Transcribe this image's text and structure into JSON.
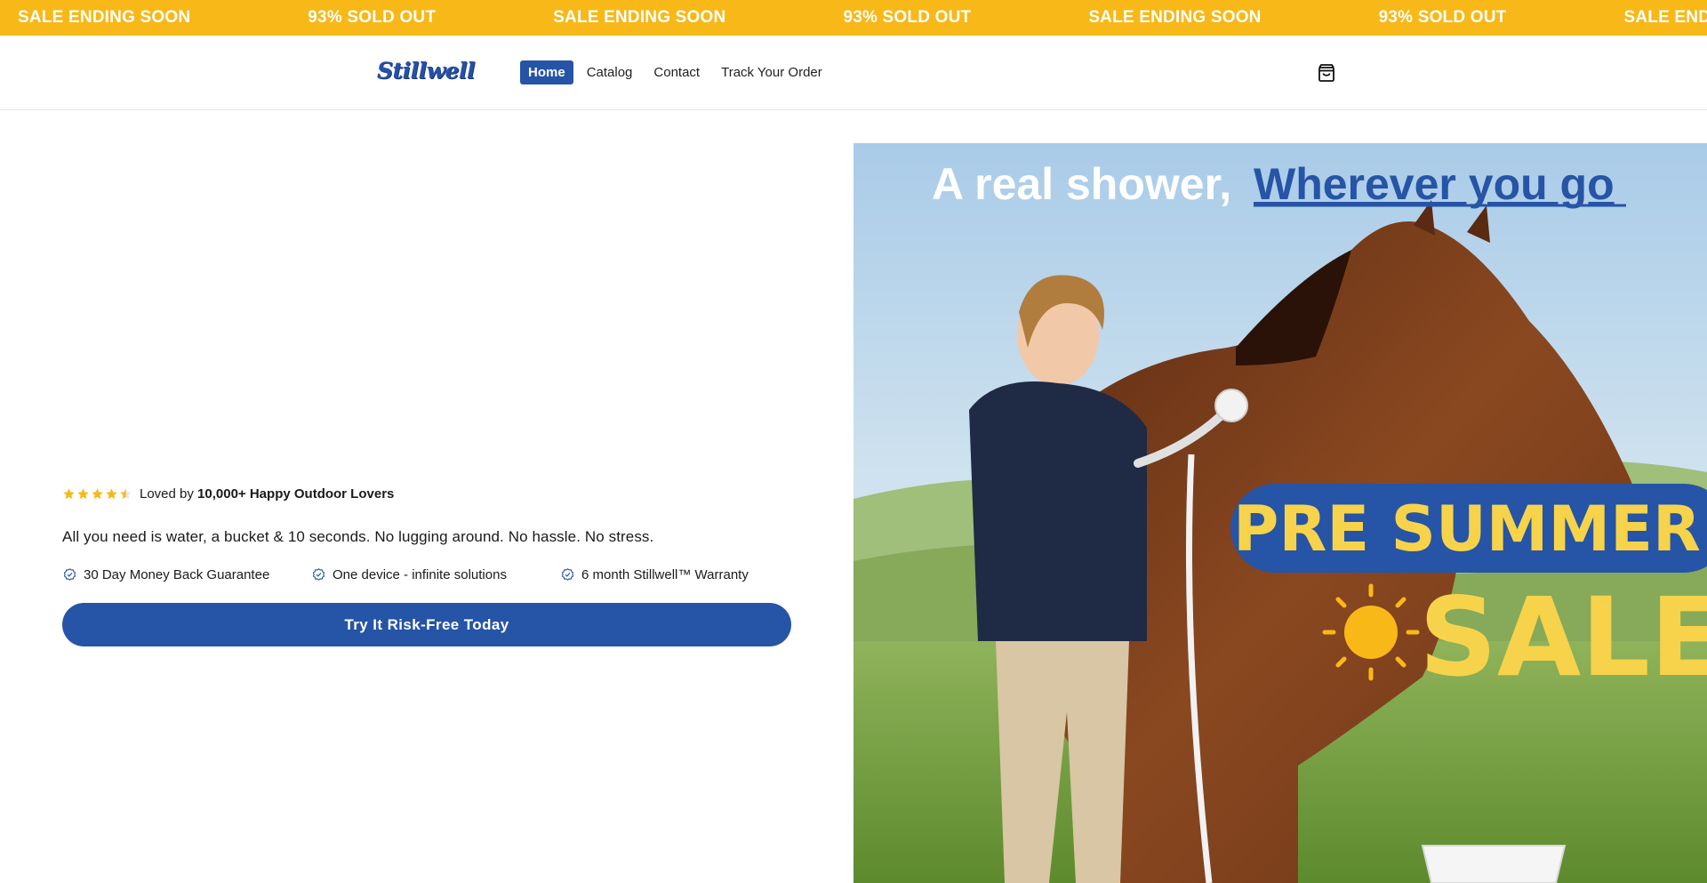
{
  "announcement": {
    "messages": [
      "SALE ENDING SOON",
      "93% SOLD OUT",
      "SALE ENDING SOON",
      "93% SOLD OUT",
      "SALE ENDING SOON",
      "93% SOLD OUT",
      "SALE ENDING SOON"
    ],
    "background": "#f8b818"
  },
  "header": {
    "logo": "Stillwell",
    "nav": [
      {
        "label": "Home",
        "active": true
      },
      {
        "label": "Catalog",
        "active": false
      },
      {
        "label": "Contact",
        "active": false
      },
      {
        "label": "Track Your Order",
        "active": false
      }
    ],
    "cart_icon": "shopping-bag-icon"
  },
  "hero": {
    "rating": {
      "stars": 4.5,
      "text_prefix": "Loved by ",
      "text_bold": "10,000+ Happy Outdoor Lovers"
    },
    "tagline": "All you need is water, a bucket & 10 seconds. No lugging around. No hassle. No stress.",
    "features": [
      {
        "icon": "badge-check-icon",
        "label": "30 Day Money Back Guarantee"
      },
      {
        "icon": "badge-check-icon",
        "label": "One device - infinite solutions"
      },
      {
        "icon": "badge-check-icon",
        "label": "6 month Stillwell™ Warranty"
      }
    ],
    "cta_label": "Try It Risk-Free Today",
    "image": {
      "headline_prefix": "A real shower, ",
      "headline_link": "Wherever you go",
      "banner_top": "PRE SUMMER",
      "banner_bottom": "SALE"
    }
  },
  "colors": {
    "brand_blue": "#2654a6",
    "accent_yellow": "#f8b818",
    "sale_yellow": "#f6d34a"
  }
}
